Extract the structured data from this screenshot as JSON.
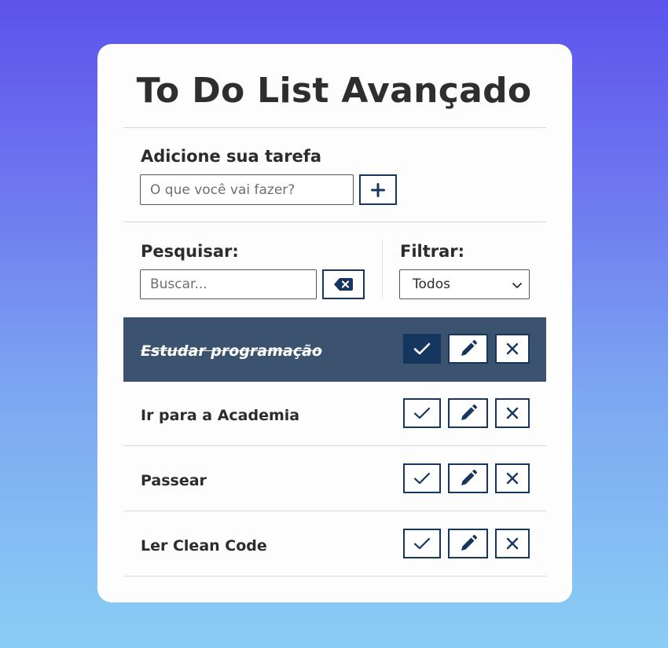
{
  "app": {
    "title": "To Do List Avançado"
  },
  "add_form": {
    "label": "Adicione sua tarefa",
    "input_placeholder": "O que você vai fazer?",
    "input_value": "",
    "add_button_icon": "plus-icon"
  },
  "search": {
    "label": "Pesquisar:",
    "input_placeholder": "Buscar...",
    "input_value": "",
    "clear_button_icon": "backspace-icon"
  },
  "filter": {
    "label": "Filtrar:",
    "selected": "Todos"
  },
  "todos": [
    {
      "text": "Estudar programação",
      "done": true
    },
    {
      "text": "Ir para a Academia",
      "done": false
    },
    {
      "text": "Passear",
      "done": false
    },
    {
      "text": "Ler Clean Code",
      "done": false
    }
  ],
  "row_actions": {
    "finish_icon": "check-icon",
    "edit_icon": "pen-icon",
    "remove_icon": "close-icon"
  },
  "colors": {
    "accent": "#15365e",
    "done_row_bg": "#3b536f",
    "gradient_top": "#5c53ec",
    "gradient_bottom": "#8acdf5"
  }
}
